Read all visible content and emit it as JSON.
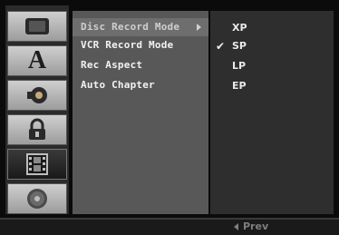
{
  "icons": [
    {
      "name": "tv-icon",
      "active": false
    },
    {
      "name": "language-icon",
      "glyph": "A",
      "active": false
    },
    {
      "name": "speaker-icon",
      "active": false
    },
    {
      "name": "lock-icon",
      "active": false
    },
    {
      "name": "film-icon",
      "active": true
    },
    {
      "name": "disc-icon",
      "active": false
    }
  ],
  "menu": {
    "items": [
      {
        "label": "Disc Record Mode",
        "selected": true
      },
      {
        "label": "VCR Record Mode",
        "selected": false
      },
      {
        "label": "Rec Aspect",
        "selected": false
      },
      {
        "label": "Auto Chapter",
        "selected": false
      }
    ]
  },
  "options": {
    "items": [
      {
        "label": "XP",
        "checked": false
      },
      {
        "label": "SP",
        "checked": true
      },
      {
        "label": "LP",
        "checked": false
      },
      {
        "label": "EP",
        "checked": false
      }
    ],
    "check_glyph": "✔"
  },
  "footer": {
    "prev_label": "Prev"
  }
}
